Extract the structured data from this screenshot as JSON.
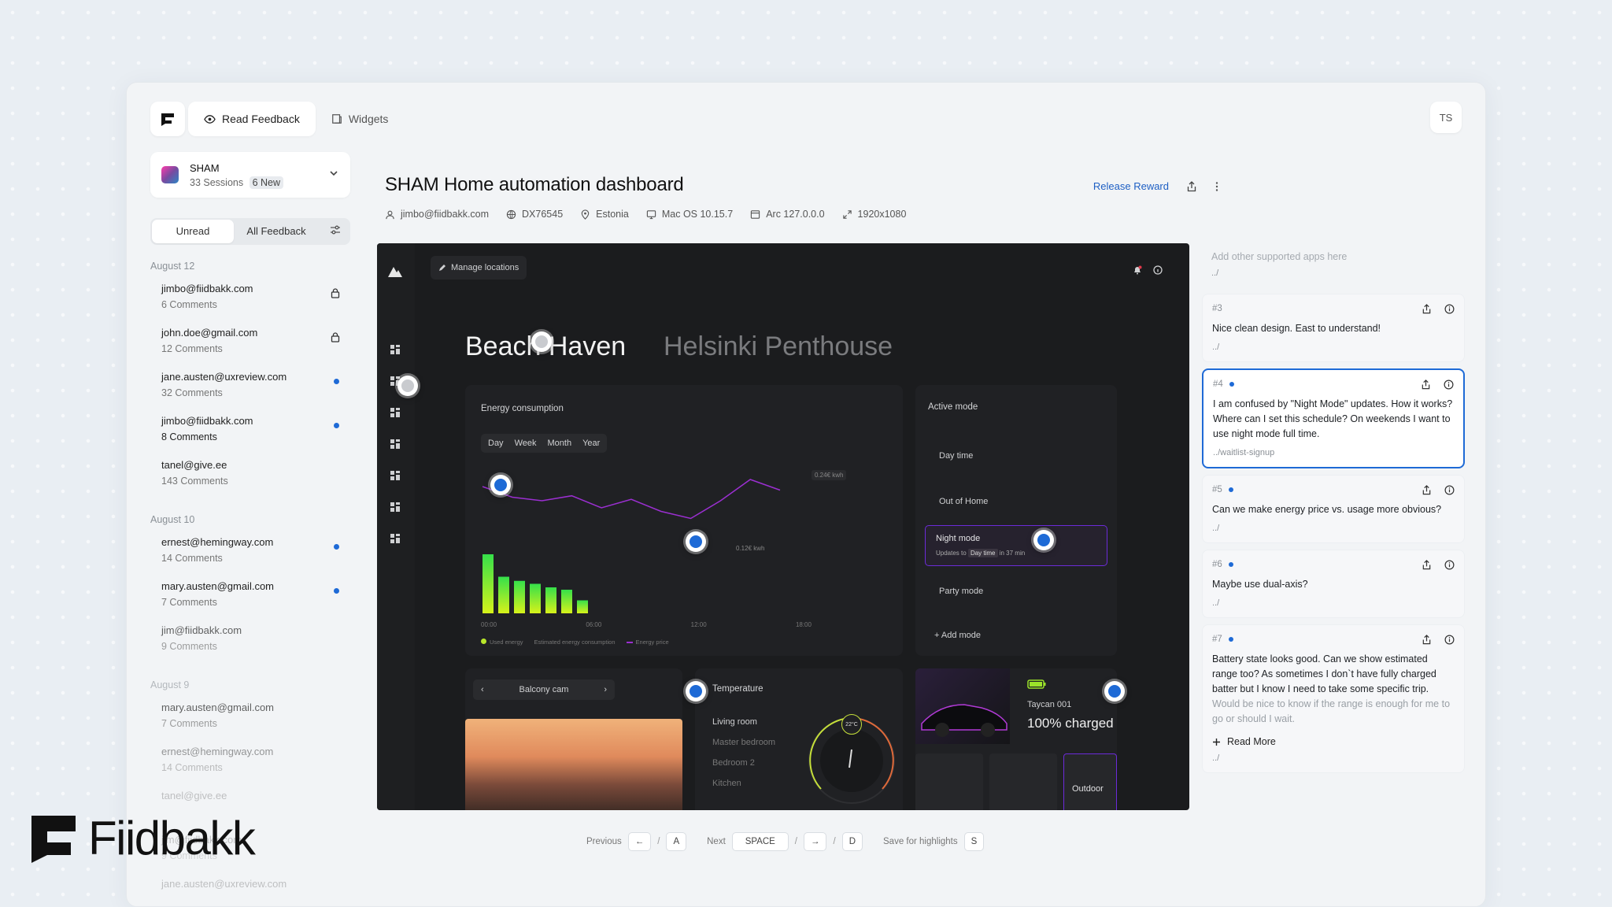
{
  "topbar": {
    "tabs": [
      {
        "label": "Read Feedback"
      },
      {
        "label": "Widgets"
      }
    ],
    "avatar_initials": "TS"
  },
  "project": {
    "name": "SHAM",
    "sessions": "33 Sessions",
    "new_badge": "6 New"
  },
  "filters": {
    "unread": "Unread",
    "all": "All Feedback"
  },
  "session_groups": [
    {
      "label": "August 12",
      "items": [
        {
          "email": "jimbo@fiidbakk.com",
          "count": "6 Comments"
        },
        {
          "email": "john.doe@gmail.com",
          "count": "12 Comments"
        },
        {
          "email": "jane.austen@uxreview.com",
          "count": "32 Comments"
        },
        {
          "email": "jimbo@fiidbakk.com",
          "count": "8 Comments"
        },
        {
          "email": "tanel@give.ee",
          "count": "143 Comments"
        }
      ]
    },
    {
      "label": "August 10",
      "items": [
        {
          "email": "ernest@hemingway.com",
          "count": "14 Comments"
        },
        {
          "email": "mary.austen@gmail.com",
          "count": "7 Comments"
        },
        {
          "email": "jim@fiidbakk.com",
          "count": "9 Comments"
        }
      ]
    },
    {
      "label": "August 9",
      "items": [
        {
          "email": "mary.austen@gmail.com",
          "count": "7 Comments"
        },
        {
          "email": "ernest@hemingway.com",
          "count": "14 Comments"
        },
        {
          "email": "tanel@give.ee",
          "count": ""
        },
        {
          "email": "jim@fiidbakk.com",
          "count": "9 Comments"
        },
        {
          "email": "jane.austen@uxreview.com",
          "count": ""
        }
      ]
    }
  ],
  "header": {
    "title": "SHAM Home automation dashboard",
    "release_reward": "Release Reward",
    "meta": {
      "email": "jimbo@fiidbakk.com",
      "id": "DX76545",
      "location": "Estonia",
      "os": "Mac OS 10.15.7",
      "browser": "Arc 127.0.0.0",
      "resolution": "1920x1080"
    }
  },
  "screenshot": {
    "manage_locations": "Manage locations",
    "location_a": "Beach Haven",
    "location_b": "Helsinki Penthouse",
    "energy": {
      "title": "Energy consumption",
      "ranges": [
        "Day",
        "Week",
        "Month",
        "Year"
      ],
      "label_high": "0.24€ kwh",
      "label_low": "0.12€ kwh",
      "times": [
        "00:00",
        "06:00",
        "12:00",
        "18:00"
      ],
      "legend": [
        "Used energy",
        "Estimated energy consumption",
        "Energy price"
      ],
      "bars": [
        1.0,
        0.62,
        0.55,
        0.5,
        0.44,
        0.4,
        0.22
      ],
      "price_line": [
        0.9,
        0.75,
        0.7,
        0.77,
        0.6,
        0.72,
        0.55,
        0.45,
        0.7,
        1.0,
        0.85
      ]
    },
    "active_mode": {
      "title": "Active mode",
      "items": [
        "Day time",
        "Out of Home",
        "Night mode",
        "Party mode"
      ],
      "night_sub_pre": "Updates to",
      "night_sub_tag": "Day time",
      "night_sub_post": "in 37 min",
      "add_mode": "Add mode"
    },
    "cam": {
      "label": "Balcony cam"
    },
    "temperature": {
      "title": "Temperature",
      "rooms": [
        "Living room",
        "Master bedroom",
        "Bedroom 2",
        "Kitchen"
      ],
      "dial_value": "22°C"
    },
    "car": {
      "name": "Taycan 001",
      "status": "100% charged",
      "tile": "Outdoor"
    }
  },
  "comments": {
    "placeholder": "Add other supported apps here",
    "path_default": "../",
    "items": [
      {
        "num": "#3",
        "dot": false,
        "text": "Nice clean design. East to understand!",
        "path": "../"
      },
      {
        "num": "#4",
        "dot": true,
        "text": "I am confused by \"Night Mode\" updates. How it works? Where can I set this schedule? On weekends I want to use night mode full time.",
        "path": "../waitlist-signup"
      },
      {
        "num": "#5",
        "dot": true,
        "text": "Can we make energy price vs. usage more obvious?",
        "path": "../"
      },
      {
        "num": "#6",
        "dot": true,
        "text": "Maybe use dual-axis?",
        "path": "../"
      },
      {
        "num": "#7",
        "dot": true,
        "text": "Battery state looks good. Can we show estimated range too? As sometimes I don`t have fully charged batter but I know I need to take some specific trip.",
        "text_fade": "Would be nice to know if the range is enough for me to go or should I wait.",
        "path": "../"
      }
    ],
    "read_more": "Read More"
  },
  "shortcuts": {
    "previous": "Previous",
    "key_a": "A",
    "next": "Next",
    "key_space": "SPACE",
    "key_d": "D",
    "save": "Save for highlights",
    "key_s": "S",
    "slash": "/"
  },
  "brand": {
    "name": "Fiidbakk"
  },
  "colors": {
    "accent": "#1e6ad6",
    "night_border": "#6c2bd9",
    "price_line": "#9b2fd1",
    "bar_top": "#35e04a",
    "bar_bottom": "#d7f21a"
  }
}
